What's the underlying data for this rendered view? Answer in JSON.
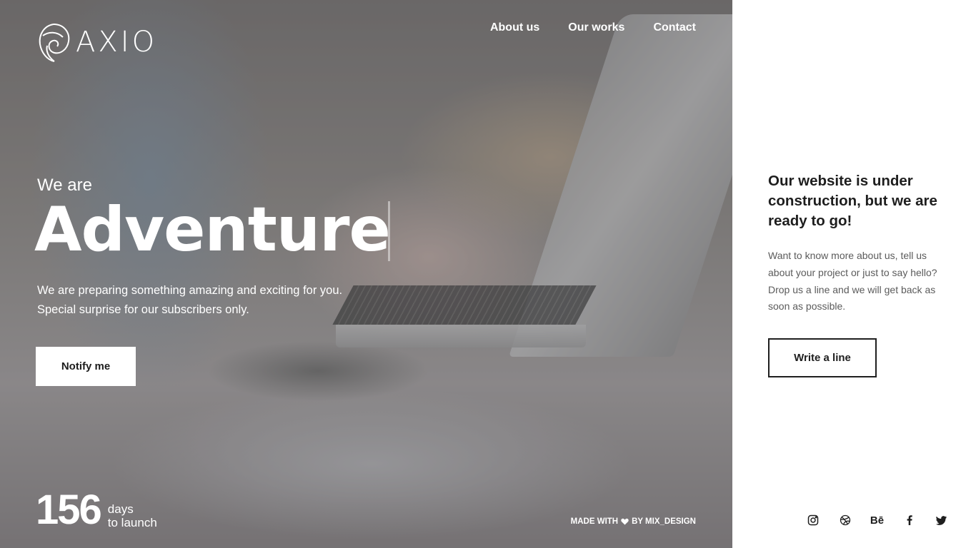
{
  "brand": {
    "name": "AXIO",
    "logo_icon": "shell-logo-icon"
  },
  "nav": {
    "items": [
      "About us",
      "Our works",
      "Contact"
    ]
  },
  "hero": {
    "intro": "We are",
    "headline": "Adventure",
    "subtitle_line1": "We are preparing something amazing and exciting for you.",
    "subtitle_line2": "Special surprise for our subscribers only.",
    "notify_label": "Notify me"
  },
  "countdown": {
    "number": "156",
    "unit": "days",
    "suffix": "to launch"
  },
  "credits": {
    "prefix": "MADE WITH",
    "suffix": "BY MIX_DESIGN"
  },
  "panel": {
    "title": "Our website is under construction, but we are ready to go!",
    "text": "Want to know more about us, tell us about your project or just to say hello? Drop us a line and we will get back as soon as possible.",
    "button_label": "Write a line"
  },
  "socials": [
    {
      "icon": "instagram-icon"
    },
    {
      "icon": "dribbble-icon"
    },
    {
      "icon": "behance-icon",
      "label": "Bē"
    },
    {
      "icon": "facebook-icon"
    },
    {
      "icon": "twitter-icon"
    }
  ],
  "colors": {
    "accent": "#ffffff",
    "text_dark": "#1e1e1e",
    "text_muted": "#5b5b5b"
  }
}
